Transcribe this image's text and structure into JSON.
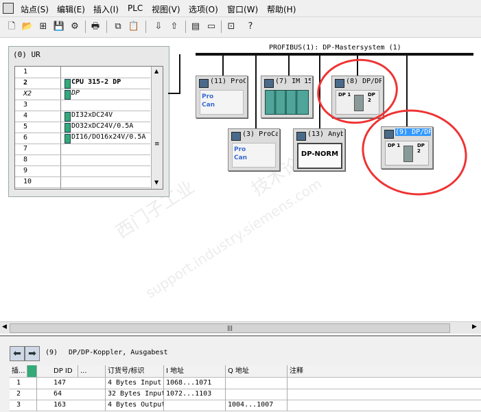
{
  "menu": [
    "站点(S)",
    "编辑(E)",
    "插入(I)",
    "PLC",
    "视图(V)",
    "选项(O)",
    "窗口(W)",
    "帮助(H)"
  ],
  "toolbar_icons": [
    "new-icon",
    "open-icon",
    "network-icon",
    "save-icon",
    "compile-icon",
    "print-icon",
    "copy-icon",
    "paste-icon",
    "download-icon",
    "upload-icon",
    "catalog-icon",
    "window-icon",
    "network-view-icon",
    "help-icon"
  ],
  "rack": {
    "title": "(0) UR",
    "rows": [
      {
        "slot": "1",
        "module": ""
      },
      {
        "slot": "2",
        "module": "CPU 315-2 DP"
      },
      {
        "slot": "X2",
        "module": "DP"
      },
      {
        "slot": "3",
        "module": ""
      },
      {
        "slot": "4",
        "module": "DI32xDC24V"
      },
      {
        "slot": "5",
        "module": "DO32xDC24V/0.5A"
      },
      {
        "slot": "6",
        "module": "DI16/DO16x24V/0.5A"
      },
      {
        "slot": "7",
        "module": ""
      },
      {
        "slot": "8",
        "module": ""
      },
      {
        "slot": "9",
        "module": ""
      },
      {
        "slot": "10",
        "module": ""
      }
    ]
  },
  "bus": {
    "label": "PROFIBUS(1): DP-Mastersystem (1)"
  },
  "nodes": [
    {
      "label": "(11) ProC",
      "image": "proc"
    },
    {
      "label": "(7) IM 15",
      "image": "im15"
    },
    {
      "label": "(8) DP/DP",
      "image": "dpdp"
    },
    {
      "label": "(3) ProCa",
      "image": "proc"
    },
    {
      "label": "(13) Anyb",
      "image": "dpnorm"
    },
    {
      "label": "(9) DP/DP",
      "image": "dpdp",
      "selected": true
    }
  ],
  "img_text": {
    "pro": "Pro",
    "can": "Can",
    "dpnorm": "DP-NORM",
    "dp1": "DP 1",
    "dp2": "DP 2"
  },
  "watermark": {
    "line1": "西门子工业",
    "line2": "support.industry.siemens.com",
    "line3": "技术论坛"
  },
  "hscroll_grip": "|||",
  "detail": {
    "id": "(9)",
    "name": "DP/DP-Koppler, Ausgabest",
    "headers": [
      "插...",
      "DP ID",
      "...",
      "订货号/标识",
      "I 地址",
      "Q 地址",
      "注释"
    ],
    "rows": [
      {
        "n": "1",
        "dpid": "147",
        "order": "4 Bytes Input",
        "i": "1068...1071",
        "q": ""
      },
      {
        "n": "2",
        "dpid": "64",
        "order": "32 Bytes Input",
        "i": "1072...1103",
        "q": ""
      },
      {
        "n": "3",
        "dpid": "163",
        "order": "4 Bytes Output",
        "i": "",
        "q": "1004...1007"
      }
    ]
  },
  "colors": {
    "highlight": "#3399ff",
    "annotation": "#e33333",
    "bus": "#111111"
  }
}
